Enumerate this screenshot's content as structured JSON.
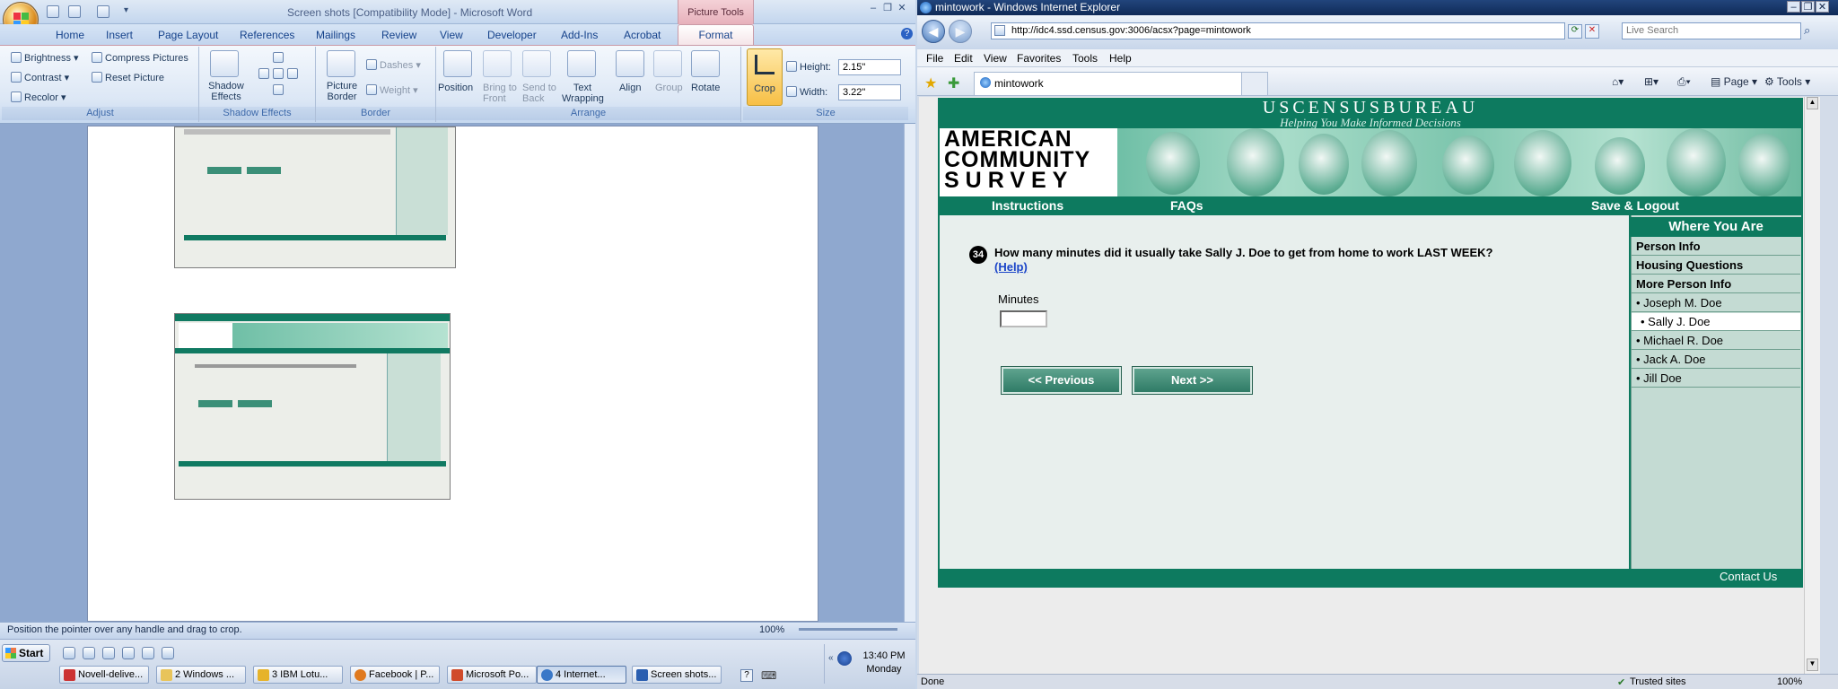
{
  "word": {
    "doc_title": "Screen shots [Compatibility Mode] - Microsoft Word",
    "picture_tools": "Picture Tools",
    "tabs": [
      "Home",
      "Insert",
      "Page Layout",
      "References",
      "Mailings",
      "Review",
      "View",
      "Developer",
      "Add-Ins",
      "Acrobat"
    ],
    "active_tab": "Format",
    "adjust": {
      "brightness": "Brightness",
      "contrast": "Contrast",
      "recolor": "Recolor",
      "compress": "Compress Pictures",
      "reset": "Reset Picture",
      "label": "Adjust"
    },
    "shadow": {
      "button": "Shadow Effects",
      "label": "Shadow Effects"
    },
    "border": {
      "picture_border": "Picture Border",
      "dashes": "Dashes",
      "weight": "Weight",
      "label": "Border"
    },
    "arrange": {
      "position": "Position",
      "bring_front": "Bring to Front",
      "send_back": "Send to Back",
      "text_wrapping": "Text Wrapping",
      "align": "Align",
      "group": "Group",
      "rotate": "Rotate",
      "label": "Arrange"
    },
    "size": {
      "crop": "Crop",
      "height_label": "Height:",
      "height_value": "2.15\"",
      "width_label": "Width:",
      "width_value": "3.22\"",
      "label": "Size"
    },
    "status_text": "Position the pointer over any handle and drag to crop.",
    "zoom": "100%"
  },
  "ie": {
    "title": "mintowork - Windows Internet Explorer",
    "url": "http://idc4.ssd.census.gov:3006/acsx?page=mintowork",
    "search_placeholder": "Live Search",
    "menu": [
      "File",
      "Edit",
      "View",
      "Favorites",
      "Tools",
      "Help"
    ],
    "tab_title": "mintowork",
    "tools": {
      "page": "Page",
      "tools": "Tools"
    },
    "status_left": "Done",
    "status_zone": "Trusted sites",
    "status_zoom": "100%"
  },
  "acs": {
    "org": "USCENSUSBUREAU",
    "tagline": "Helping You Make Informed Decisions",
    "title_lines": [
      "AMERICAN",
      "COMMUNITY",
      "SURVEY"
    ],
    "nav": {
      "instructions": "Instructions",
      "faqs": "FAQs",
      "save_logout": "Save & Logout"
    },
    "question_number": "34",
    "question": "How many minutes did it usually take Sally J. Doe to get from home to work LAST WEEK?",
    "help": "(Help)",
    "minutes_label": "Minutes",
    "minutes_value": "",
    "prev": "<<  Previous",
    "next": "Next  >>",
    "sidebar": {
      "header": "Where You Are",
      "sections": [
        "Person Info",
        "Housing Questions",
        "More Person Info"
      ],
      "people": [
        "• Joseph M. Doe",
        "• Sally J. Doe",
        "• Michael R. Doe",
        "• Jack A. Doe",
        "• Jill Doe"
      ],
      "selected": "• Sally J. Doe"
    },
    "contact": "Contact Us"
  },
  "taskbar": {
    "start": "Start",
    "tasks": [
      "Novell-delive...",
      "2 Windows ...",
      "3 IBM Lotu...",
      "Facebook | P...",
      "Microsoft Po...",
      "4 Internet...",
      "Screen shots..."
    ],
    "time": "13:40 PM",
    "day": "Monday"
  }
}
